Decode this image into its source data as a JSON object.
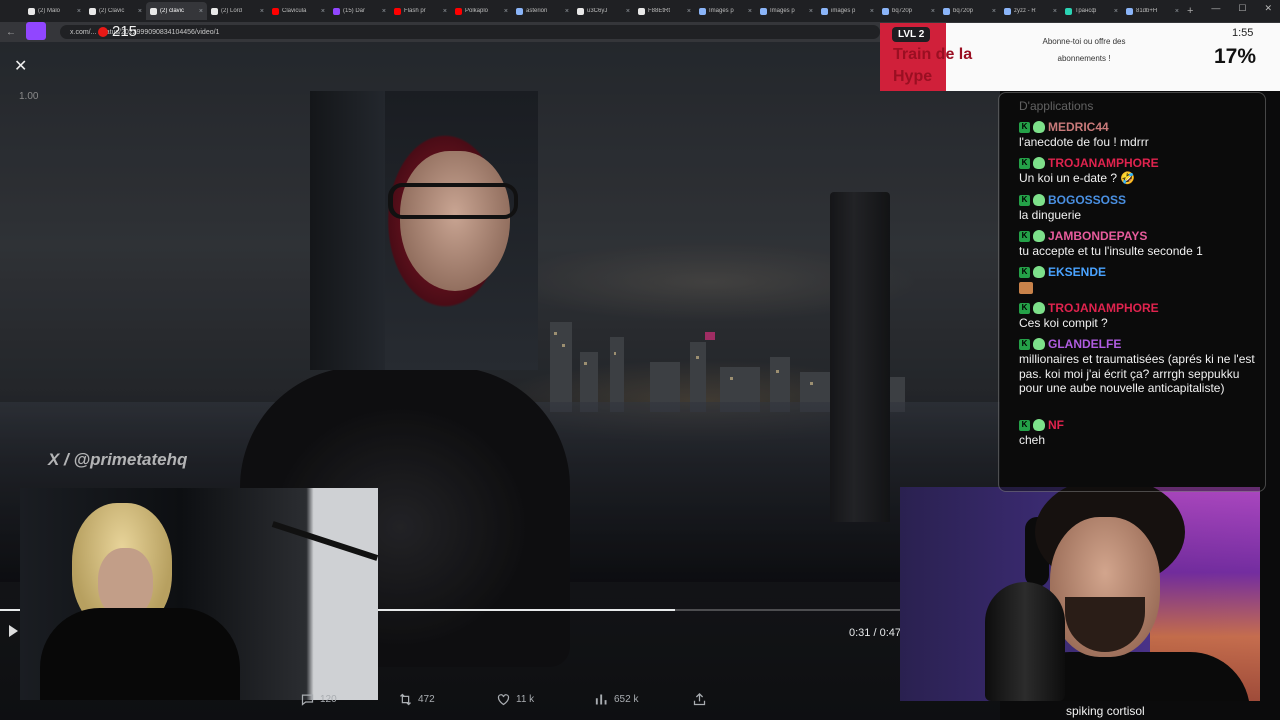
{
  "browser": {
    "tabs": [
      {
        "label": "(2) Malo",
        "color": "#e8e8e8",
        "active": false
      },
      {
        "label": "(2) Clavic",
        "color": "#e8e8e8",
        "active": false
      },
      {
        "label": "(2) clavic",
        "color": "#e8e8e8",
        "active": true
      },
      {
        "label": "(2) Lord",
        "color": "#e8e8e8",
        "active": false
      },
      {
        "label": "Clavicula",
        "color": "#ff0000",
        "active": false
      },
      {
        "label": "(15) Dar",
        "color": "#9146ff",
        "active": false
      },
      {
        "label": "Flash pr",
        "color": "#ff0000",
        "active": false
      },
      {
        "label": "Polkaplo",
        "color": "#ff0000",
        "active": false
      },
      {
        "label": "asterion",
        "color": "#8ab4f8",
        "active": false
      },
      {
        "label": "u3C6yJ",
        "color": "#e8e8e8",
        "active": false
      },
      {
        "label": "F88EtRt",
        "color": "#e8e8e8",
        "active": false
      },
      {
        "label": "Images p",
        "color": "#8ab4f8",
        "active": false
      },
      {
        "label": "Images p",
        "color": "#8ab4f8",
        "active": false
      },
      {
        "label": "images p",
        "color": "#8ab4f8",
        "active": false
      },
      {
        "label": "bq720p",
        "color": "#8ab4f8",
        "active": false
      },
      {
        "label": "bq720p",
        "color": "#8ab4f8",
        "active": false
      },
      {
        "label": "zyzz - R",
        "color": "#8ab4f8",
        "active": false
      },
      {
        "label": "Трансф",
        "color": "#2bd4b4",
        "active": false
      },
      {
        "label": "81db+H",
        "color": "#8ab4f8",
        "active": false
      }
    ],
    "url": "x.com/... /status/2022999090834104456/video/1",
    "viewer_count": "215"
  },
  "video": {
    "speed": "1.00",
    "watermark": "X / @primetatehq",
    "time": "0:31 / 0:47",
    "progress": 0.75,
    "actions": [
      {
        "icon": "reply-icon",
        "count": "120"
      },
      {
        "icon": "retweet-icon",
        "count": "472"
      },
      {
        "icon": "heart-icon",
        "count": "11 k"
      },
      {
        "icon": "views-icon",
        "count": "652 k"
      },
      {
        "icon": "share-icon",
        "count": ""
      }
    ]
  },
  "hype_train": {
    "level": "LVL 2",
    "title_line1": "Train de la",
    "title_line2": "Hype",
    "message_line1": "Abonne-toi ou offre des",
    "message_line2": "abonnements !",
    "timer": "1:55",
    "percent": "17%",
    "accent": "#d0203a"
  },
  "chat": {
    "faded_top": "D'applications",
    "messages": [
      {
        "user": "MEDRIC44",
        "color": "#c97a7a",
        "text": "l'anecdote de fou ! mdrrr"
      },
      {
        "user": "TROJANAMPHORE",
        "color": "#e0234e",
        "text": "Un koi un e-date ? 🤣"
      },
      {
        "user": "BOGOSSOSS",
        "color": "#4a90e2",
        "text": "la dinguerie"
      },
      {
        "user": "JAMBONDEPAYS",
        "color": "#e85c9c",
        "text": "tu accepte et tu l'insulte seconde 1"
      },
      {
        "user": "EKSENDE",
        "color": "#4aa3ff",
        "text": ""
      },
      {
        "user": "TROJANAMPHORE",
        "color": "#e0234e",
        "text": "Ces koi compit ?"
      },
      {
        "user": "GLANDELFE",
        "color": "#b05ce0",
        "text": "millionaires et traumatisées (aprés ki ne l'est pas. koi moi j'ai écrit ça? arrrgh seppukku pour une aube nouvelle anticapitaliste)"
      },
      {
        "user": "NF",
        "color": "#e0234e",
        "text": "cheh"
      }
    ]
  },
  "webcam_caption": "spiking cortisol"
}
